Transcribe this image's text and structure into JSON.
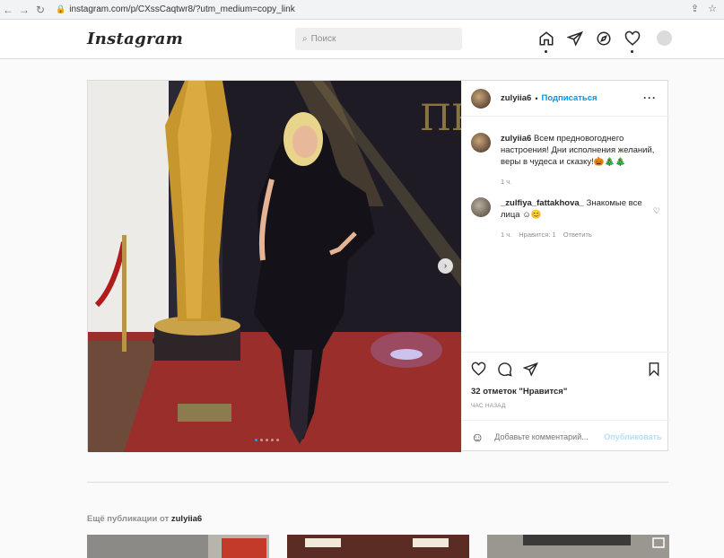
{
  "browser": {
    "url": "instagram.com/p/CXssCaqtwr8/?utm_medium=copy_link",
    "back_icon": "←",
    "forward_icon": "→",
    "reload_icon": "↻"
  },
  "header": {
    "logo": "Instagram",
    "search_placeholder": "Поиск"
  },
  "post": {
    "username": "zulyiia6",
    "separator": "•",
    "follow_label": "Подписаться",
    "more_label": "···",
    "caption_user": "zulyiia6",
    "caption_text": "Всем предновогоднего настроения! Дни исполнения желаний, веры в чудеса и сказку!🎃🎄🎄",
    "caption_time": "1 ч.",
    "comment": {
      "user": "_zulfiya_fattakhova_",
      "text": "Знакомые все лица ☺😊",
      "time": "1 ч.",
      "likes": "Нравится: 1",
      "reply": "Ответить"
    },
    "likes_text": "32 отметок \"Нравится\"",
    "time_ago": "час назад",
    "add_comment_placeholder": "Добавьте комментарий...",
    "publish_label": "Опубликовать",
    "carousel": {
      "current": 1,
      "total": 5
    }
  },
  "more_posts": {
    "label": "Ещё публикации от",
    "user": "zulyiia6"
  },
  "colors": {
    "accent": "#0095f6",
    "like": "#ed4956",
    "background": "#fafafa"
  }
}
